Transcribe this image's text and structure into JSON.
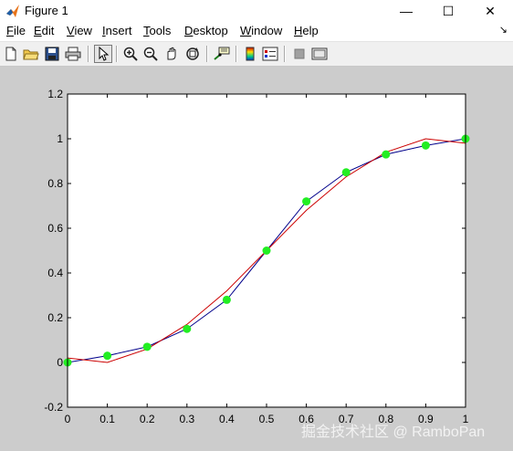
{
  "window": {
    "title": "Figure 1",
    "minimize_glyph": "—",
    "maximize_glyph": "☐",
    "close_glyph": "✕"
  },
  "menu": {
    "items": [
      {
        "label": "File",
        "u": "F",
        "rest": "ile"
      },
      {
        "label": "Edit",
        "u": "E",
        "rest": "dit"
      },
      {
        "label": "View",
        "u": "V",
        "rest": "iew"
      },
      {
        "label": "Insert",
        "u": "I",
        "rest": "nsert"
      },
      {
        "label": "Tools",
        "u": "T",
        "rest": "ools"
      },
      {
        "label": "Desktop",
        "u": "D",
        "rest": "esktop"
      },
      {
        "label": "Window",
        "u": "W",
        "rest": "indow"
      },
      {
        "label": "Help",
        "u": "H",
        "rest": "elp"
      }
    ],
    "dock_glyph": "↘"
  },
  "toolbar": {
    "buttons": [
      "new-figure-icon",
      "open-folder-icon",
      "save-icon",
      "print-icon",
      "edit-plot-arrow-icon",
      "zoom-in-icon",
      "zoom-out-icon",
      "pan-hand-icon",
      "rotate-3d-icon",
      "data-cursor-icon",
      "insert-colorbar-icon",
      "insert-legend-icon",
      "hide-plot-tools-icon",
      "show-plot-tools-icon"
    ]
  },
  "colors": {
    "background": "#cccccc",
    "axes": "#ffffff",
    "blue_series": "#00008b",
    "red_series": "#cc0000",
    "markers": "#22ee22"
  },
  "chart_data": {
    "type": "line",
    "xlim": [
      0,
      1
    ],
    "ylim": [
      -0.2,
      1.2
    ],
    "xticks": [
      "0",
      "0.1",
      "0.2",
      "0.3",
      "0.4",
      "0.5",
      "0.6",
      "0.7",
      "0.8",
      "0.9",
      "1"
    ],
    "yticks": [
      "-0.2",
      "0",
      "0.2",
      "0.4",
      "0.6",
      "0.8",
      "1",
      "1.2"
    ],
    "grid": false,
    "series": [
      {
        "color": "blue",
        "style": "line+markers",
        "x": [
          0,
          0.1,
          0.2,
          0.3,
          0.4,
          0.5,
          0.6,
          0.7,
          0.8,
          0.9,
          1
        ],
        "y": [
          0,
          0.03,
          0.07,
          0.15,
          0.28,
          0.5,
          0.72,
          0.85,
          0.93,
          0.97,
          1
        ]
      },
      {
        "color": "red",
        "style": "line",
        "x": [
          0,
          0.1,
          0.2,
          0.3,
          0.4,
          0.5,
          0.6,
          0.7,
          0.8,
          0.9,
          1
        ],
        "y": [
          0.02,
          0,
          0.06,
          0.17,
          0.32,
          0.5,
          0.68,
          0.83,
          0.94,
          1,
          0.98
        ]
      }
    ]
  },
  "watermark": "掘金技术社区 @ RamboPan"
}
